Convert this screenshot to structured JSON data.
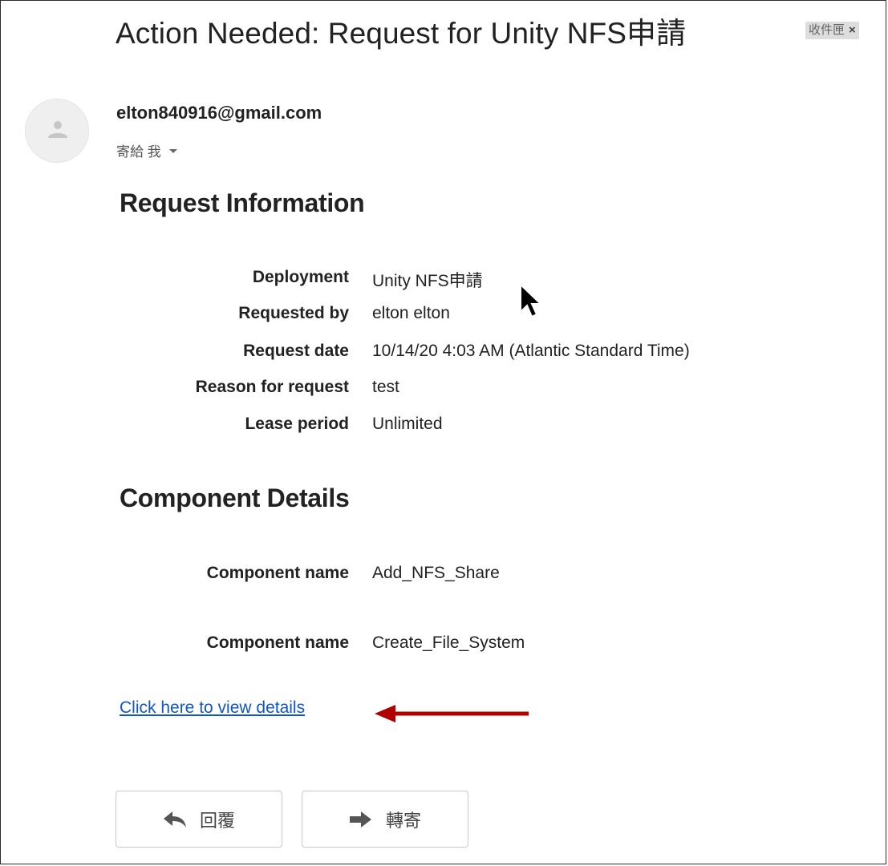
{
  "email": {
    "subject": "Action Needed: Request for Unity NFS申請",
    "inbox_label": "收件匣",
    "inbox_label_remove": "×",
    "sender": "elton840916@gmail.com",
    "to_me": "寄給 我"
  },
  "request_information": {
    "heading": "Request Information",
    "rows": [
      {
        "label": "Deployment",
        "value": "Unity NFS申請"
      },
      {
        "label": "Requested by",
        "value": "elton elton"
      },
      {
        "label": "Request date",
        "value": "10/14/20 4:03 AM (Atlantic Standard Time)"
      },
      {
        "label": "Reason for request",
        "value": "test"
      },
      {
        "label": "Lease period",
        "value": "Unlimited"
      }
    ]
  },
  "component_details": {
    "heading": "Component Details",
    "rows": [
      {
        "label": "Component name",
        "value": "Add_NFS_Share"
      },
      {
        "label": "Component name",
        "value": "Create_File_System"
      }
    ]
  },
  "details_link": "Click here to view details",
  "actions": {
    "reply_label": "回覆",
    "forward_label": "轉寄"
  },
  "colors": {
    "link": "#1155cc",
    "annotation_arrow": "#b00000",
    "label_chip": "#dddddd"
  },
  "icons": {
    "avatar": "person-icon",
    "reply": "reply-arrow-icon",
    "forward": "forward-arrow-icon",
    "menu": "caret-down-icon"
  }
}
